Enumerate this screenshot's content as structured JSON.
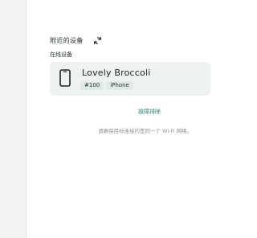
{
  "nearby": {
    "title": "附近的设备",
    "online_label": "在线设备"
  },
  "device": {
    "name": "Lovely Broccoli",
    "tags": [
      "#100",
      "iPhone"
    ]
  },
  "troubleshoot_label": "故障排除",
  "hint": "请确保目标连接的是同一个 Wi-Fi 网络。",
  "colors": {
    "accent": "#2e7d6f",
    "card_bg": "#eef3f1",
    "rail_bg": "#f1f4f3"
  },
  "icons": {
    "refresh": "refresh-icon",
    "device": "phone-icon"
  }
}
